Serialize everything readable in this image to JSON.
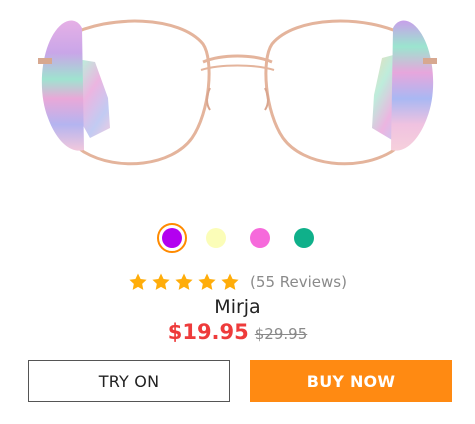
{
  "product": {
    "name": "Mirja",
    "price_current": "$19.95",
    "price_original": "$29.95",
    "reviews_text": "(55 Reviews)",
    "rating": 5,
    "rating_max": 5
  },
  "swatches": [
    {
      "name": "purple",
      "color": "#b300f0",
      "selected": true
    },
    {
      "name": "light-yellow",
      "color": "#fbfdb8",
      "selected": false
    },
    {
      "name": "pink",
      "color": "#f66adb",
      "selected": false
    },
    {
      "name": "teal",
      "color": "#0fb08a",
      "selected": false
    }
  ],
  "buttons": {
    "try_on_label": "TRY ON",
    "buy_now_label": "BUY NOW"
  },
  "colors": {
    "accent_orange": "#ff8a12",
    "star_color": "#ffad0a",
    "price_red": "#ee3b3b",
    "frame_rose_gold": "#e8b9a2"
  },
  "icons": {
    "star": "star-icon"
  }
}
